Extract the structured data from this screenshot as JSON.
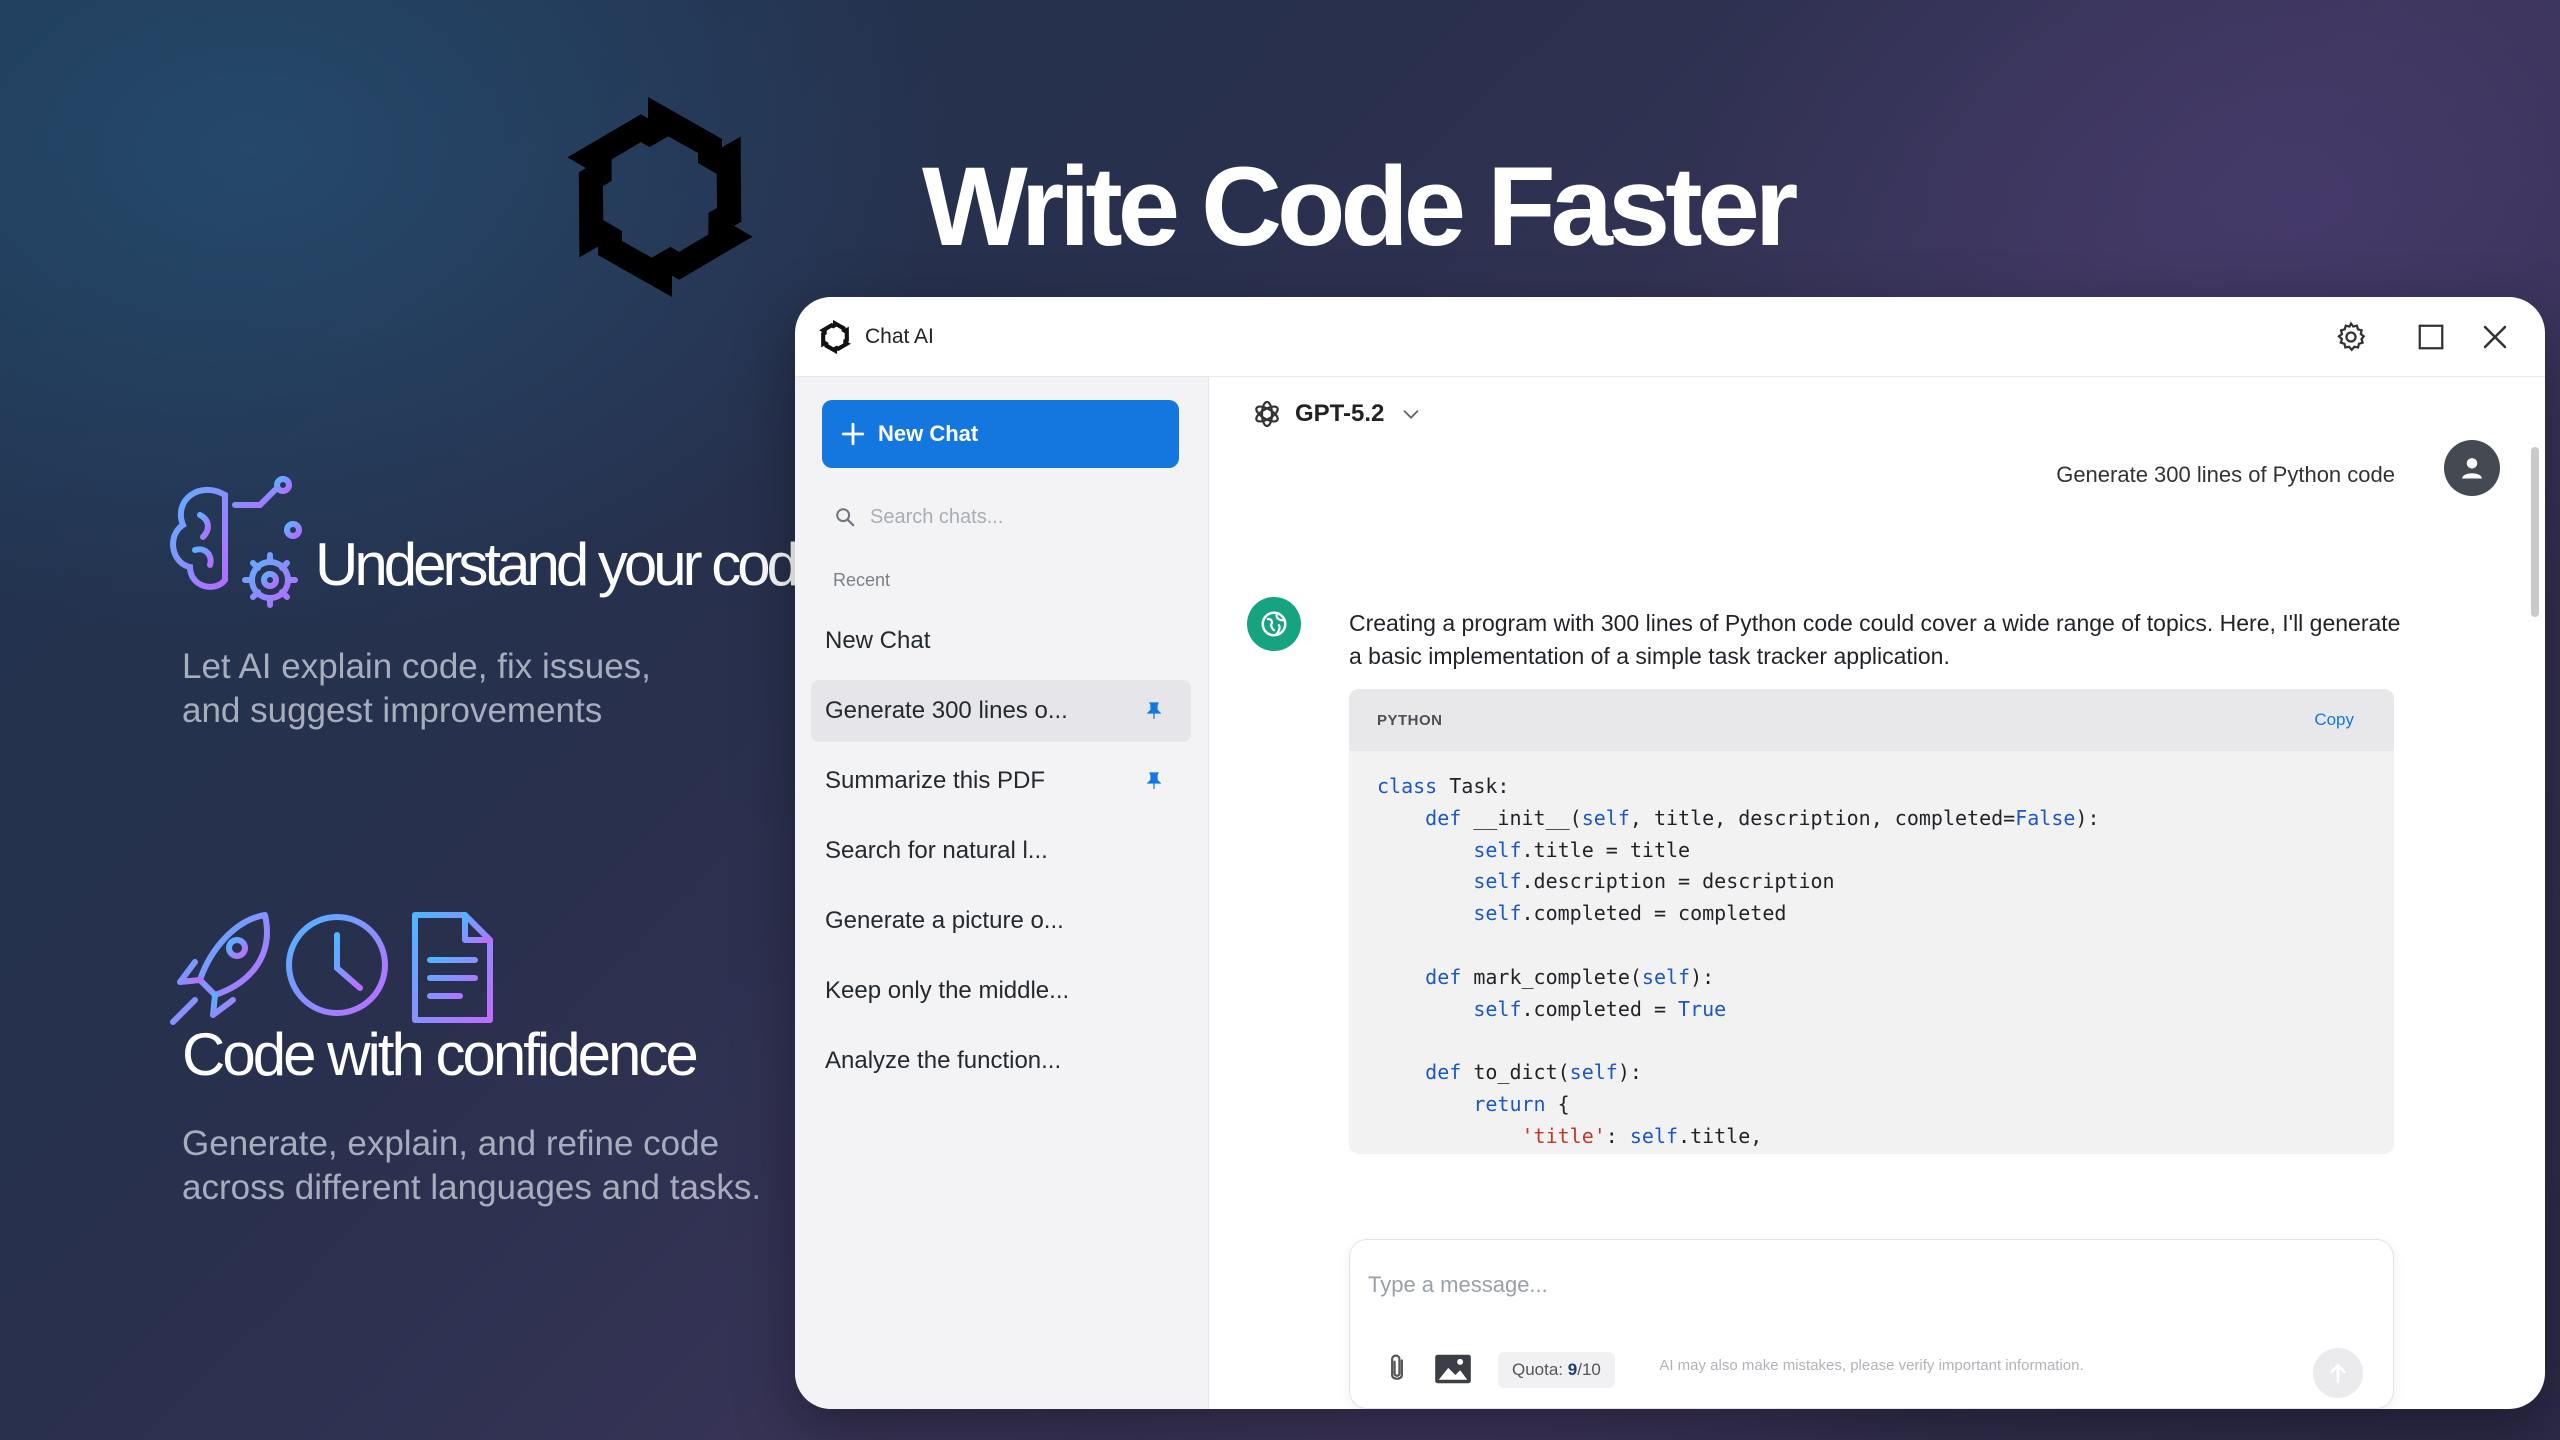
{
  "hero": {
    "headline": "Write Code Faster"
  },
  "features": [
    {
      "title": "Understand your code",
      "description": "Let AI explain code, fix issues, and suggest improvements",
      "icons": [
        "brain-gear-icon"
      ]
    },
    {
      "title": "Code with confidence",
      "description": "Generate, explain, and refine code across different languages and tasks.",
      "icons": [
        "rocket-icon",
        "clock-icon",
        "document-icon"
      ]
    }
  ],
  "window": {
    "title": "Chat AI",
    "controls": [
      "settings-icon",
      "maximize-icon",
      "close-icon"
    ]
  },
  "sidebar": {
    "new_chat_label": "New Chat",
    "search_placeholder": "Search chats...",
    "recent_label": "Recent",
    "chats": [
      {
        "label": "New Chat",
        "pinned": false,
        "active": false
      },
      {
        "label": "Generate 300 lines o...",
        "pinned": true,
        "active": true
      },
      {
        "label": "Summarize this PDF",
        "pinned": true,
        "active": false
      },
      {
        "label": "Search for natural l...",
        "pinned": false,
        "active": false
      },
      {
        "label": "Generate a picture o...",
        "pinned": false,
        "active": false
      },
      {
        "label": "Keep only the middle...",
        "pinned": false,
        "active": false
      },
      {
        "label": "Analyze the function...",
        "pinned": false,
        "active": false
      }
    ]
  },
  "main": {
    "model_name": "GPT-5.2",
    "user_message": "Generate 300 lines of Python code",
    "ai_message": "Creating a program with 300 lines of Python code could cover a wide range of topics. Here, I'll generate a basic implementation of a simple task tracker application.",
    "code": {
      "language": "PYTHON",
      "copy_label": "Copy",
      "lines": [
        "class Task:",
        "    def __init__(self, title, description, completed=False):",
        "        self.title = title",
        "        self.description = description",
        "        self.completed = completed",
        "",
        "    def mark_complete(self):",
        "        self.completed = True",
        "",
        "    def to_dict(self):",
        "        return {",
        "            'title': self.title,"
      ]
    },
    "composer": {
      "placeholder": "Type a message...",
      "quota_label": "Quota:",
      "quota_used": "9",
      "quota_total": "/10"
    },
    "disclaimer": "AI may also make mistakes, please verify important information."
  },
  "colors": {
    "accent": "#1477e0",
    "ai_avatar": "#16a37f",
    "keyword": "#1c57c4",
    "string": "#c0392b"
  }
}
